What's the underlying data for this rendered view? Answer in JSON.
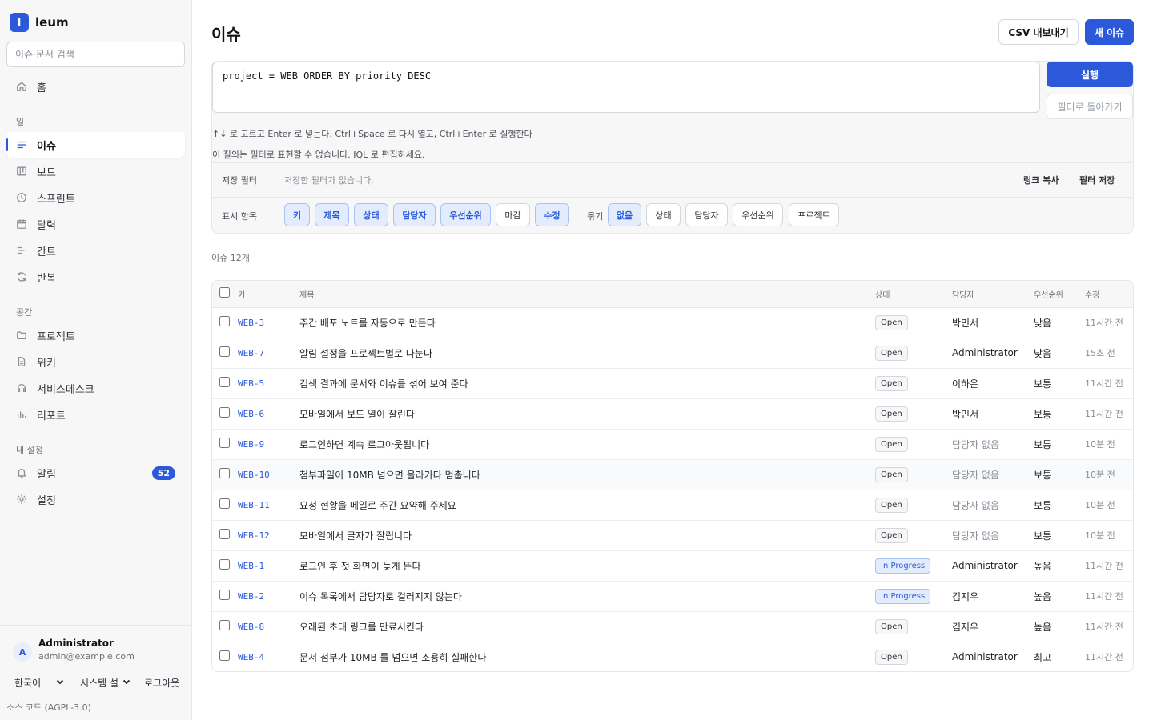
{
  "brand": {
    "logo_letter": "I",
    "name": "leum"
  },
  "search": {
    "placeholder": "이슈·문서 검색"
  },
  "nav": {
    "home": "홈",
    "section_work": "일",
    "issues": "이슈",
    "board": "보드",
    "sprint": "스프린트",
    "calendar": "달력",
    "gantt": "간트",
    "recurring": "반복",
    "section_space": "공간",
    "projects": "프로젝트",
    "wiki": "위키",
    "servicedesk": "서비스데스크",
    "reports": "리포트",
    "section_my": "내 설정",
    "notifications": "알림",
    "notification_count": "52",
    "settings": "설정"
  },
  "user": {
    "avatar_letter": "A",
    "name": "Administrator",
    "email": "admin@example.com"
  },
  "footer": {
    "language": "한국어",
    "system": "시스템 설",
    "logout": "로그아웃",
    "source": "소스 코드 (AGPL-3.0)"
  },
  "header": {
    "title": "이슈",
    "export_label": "CSV 내보내기",
    "new_label": "새 이슈"
  },
  "query": {
    "value": "project = WEB ORDER BY priority DESC",
    "run_label": "실행",
    "back_label": "필터로 돌아가기",
    "hint1": "↑↓ 로 고르고 Enter 로 넣는다. Ctrl+Space 로 다시 열고, Ctrl+Enter 로 실행한다",
    "hint2": "이 질의는 필터로 표현할 수 없습니다. IQL 로 편집하세요."
  },
  "saved": {
    "label": "저장 필터",
    "empty": "저장한 필터가 없습니다.",
    "copy_link": "링크 복사",
    "save_filter": "필터 저장"
  },
  "display": {
    "label": "표시 항목",
    "columns": [
      "키",
      "제목",
      "상태",
      "담당자",
      "우선순위",
      "마감",
      "수정"
    ],
    "group_label": "묶기",
    "group_options": [
      "없음",
      "상태",
      "담당자",
      "우선순위",
      "프로젝트"
    ]
  },
  "count_label": "이슈 12개",
  "table": {
    "headers": [
      "키",
      "제목",
      "상태",
      "담당자",
      "우선순위",
      "수정"
    ],
    "rows": [
      {
        "key": "WEB-3",
        "title": "주간 배포 노트를 자동으로 만든다",
        "status": "Open",
        "assignee": "박민서",
        "priority": "낮음",
        "updated": "11시간 전"
      },
      {
        "key": "WEB-7",
        "title": "알림 설정을 프로젝트별로 나눈다",
        "status": "Open",
        "assignee": "Administrator",
        "priority": "낮음",
        "updated": "15초 전"
      },
      {
        "key": "WEB-5",
        "title": "검색 결과에 문서와 이슈를 섞어 보여 준다",
        "status": "Open",
        "assignee": "이하은",
        "priority": "보통",
        "updated": "11시간 전"
      },
      {
        "key": "WEB-6",
        "title": "모바일에서 보드 열이 잘린다",
        "status": "Open",
        "assignee": "박민서",
        "priority": "보통",
        "updated": "11시간 전"
      },
      {
        "key": "WEB-9",
        "title": "로그인하면 계속 로그아웃됩니다",
        "status": "Open",
        "assignee": "담당자 없음",
        "priority": "보통",
        "updated": "10분 전"
      },
      {
        "key": "WEB-10",
        "title": "첨부파일이 10MB 넘으면 올라가다 멈춥니다",
        "status": "Open",
        "assignee": "담당자 없음",
        "priority": "보통",
        "updated": "10분 전"
      },
      {
        "key": "WEB-11",
        "title": "요청 현황을 메일로 주간 요약해 주세요",
        "status": "Open",
        "assignee": "담당자 없음",
        "priority": "보통",
        "updated": "10분 전"
      },
      {
        "key": "WEB-12",
        "title": "모바일에서 글자가 잘립니다",
        "status": "Open",
        "assignee": "담당자 없음",
        "priority": "보통",
        "updated": "10분 전"
      },
      {
        "key": "WEB-1",
        "title": "로그인 후 첫 화면이 늦게 뜬다",
        "status": "In Progress",
        "assignee": "Administrator",
        "priority": "높음",
        "updated": "11시간 전"
      },
      {
        "key": "WEB-2",
        "title": "이슈 목록에서 담당자로 걸러지지 않는다",
        "status": "In Progress",
        "assignee": "김지우",
        "priority": "높음",
        "updated": "11시간 전"
      },
      {
        "key": "WEB-8",
        "title": "오래된 초대 링크를 만료시킨다",
        "status": "Open",
        "assignee": "김지우",
        "priority": "높음",
        "updated": "11시간 전"
      },
      {
        "key": "WEB-4",
        "title": "문서 첨부가 10MB 를 넘으면 조용히 실패한다",
        "status": "Open",
        "assignee": "Administrator",
        "priority": "최고",
        "updated": "11시간 전"
      }
    ]
  },
  "colors": {
    "accent": "#2b59d9",
    "sidebar_bg": "#f7f7f8",
    "border": "#e5e7eb"
  }
}
